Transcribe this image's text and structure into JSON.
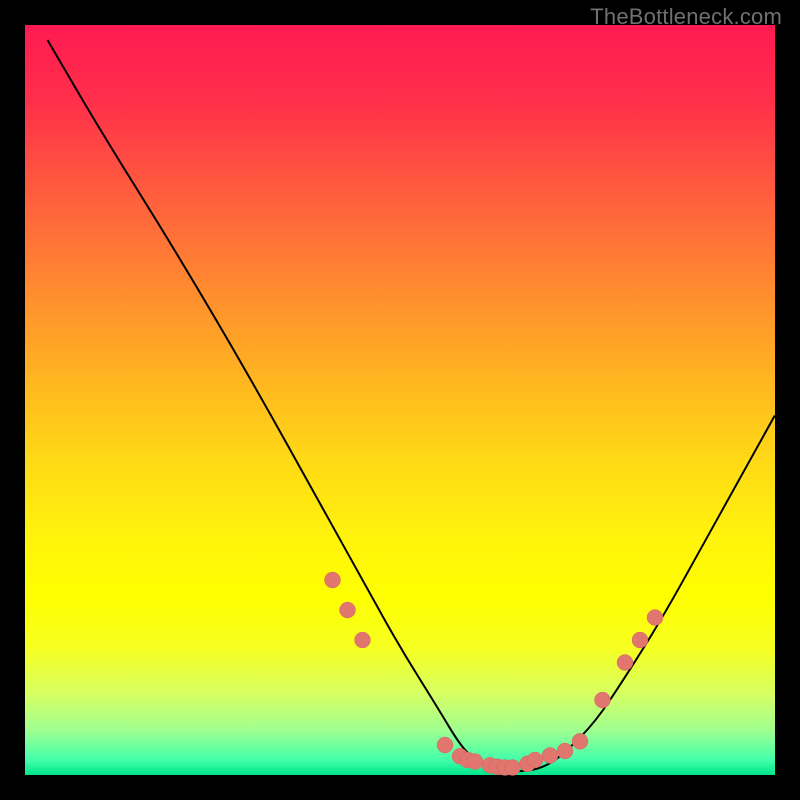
{
  "watermark_text": "TheBottleneck.com",
  "chart_data": {
    "type": "line",
    "title": "",
    "xlabel": "",
    "ylabel": "",
    "xlim": [
      0,
      100
    ],
    "ylim": [
      0,
      100
    ],
    "grid": false,
    "legend": false,
    "background": "red-yellow-green vertical gradient (red top, green bottom)",
    "series": [
      {
        "name": "bottleneck-curve",
        "color": "#000000",
        "x": [
          3,
          10,
          20,
          30,
          40,
          45,
          50,
          55,
          58,
          60,
          62,
          64,
          66,
          68,
          70,
          72,
          76,
          80,
          85,
          90,
          95,
          100
        ],
        "y": [
          98,
          86,
          70,
          53,
          35,
          26,
          17,
          9,
          4,
          2,
          1,
          0.5,
          0.5,
          0.7,
          1.5,
          3,
          7,
          13,
          21,
          30,
          39,
          48
        ]
      }
    ],
    "markers": [
      {
        "name": "left-cluster",
        "x": [
          41,
          43,
          45
        ],
        "y": [
          26,
          22,
          18
        ]
      },
      {
        "name": "valley-cluster",
        "x": [
          56,
          58,
          59,
          60,
          62,
          63,
          64,
          65,
          67,
          68,
          70,
          72,
          74
        ],
        "y": [
          4,
          2.5,
          2,
          1.8,
          1.3,
          1.1,
          1.0,
          1.0,
          1.5,
          2,
          2.6,
          3.2,
          4.5
        ]
      },
      {
        "name": "right-cluster",
        "x": [
          77,
          80,
          82,
          84
        ],
        "y": [
          10,
          15,
          18,
          21
        ]
      }
    ]
  }
}
